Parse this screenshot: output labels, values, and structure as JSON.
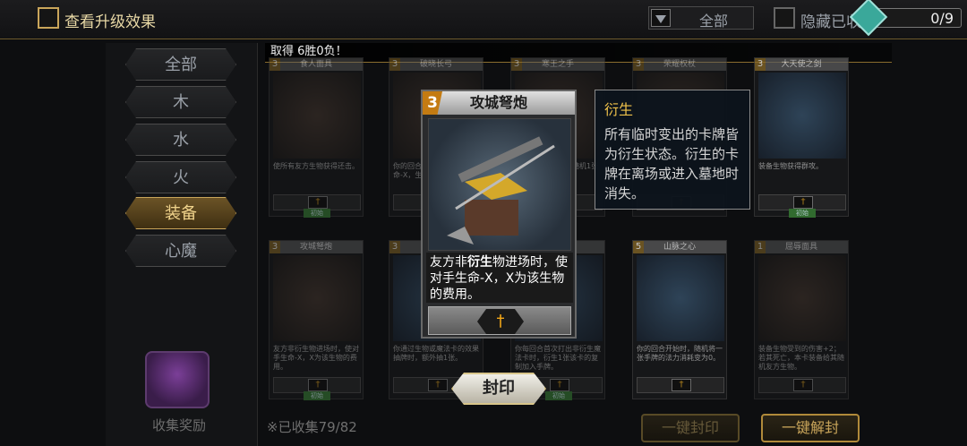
{
  "topbar": {
    "show_upgrade_label": "查看升级效果",
    "filter_value": "全部",
    "hide_label": "隐藏已收",
    "counter": "0/9"
  },
  "notice": "取得 6胜0负！",
  "sidebar": {
    "tabs": [
      {
        "label": "全部",
        "active": false
      },
      {
        "label": "木",
        "active": false
      },
      {
        "label": "水",
        "active": false
      },
      {
        "label": "火",
        "active": false
      },
      {
        "label": "装备",
        "active": true
      },
      {
        "label": "心魔",
        "active": false
      }
    ],
    "collect_label": "收集奖励"
  },
  "cards": [
    {
      "cost": "3",
      "title": "食人面具",
      "text": "使所有友方生物获得还击。",
      "tag": "初始"
    },
    {
      "cost": "3",
      "title": "破晓长弓",
      "text": "你的回合开始时，对友方生命-X，生物复苏。",
      "tag": ""
    },
    {
      "cost": "3",
      "title": "寒王之手",
      "text": "敌方生物进场时，随机1张",
      "tag": ""
    },
    {
      "cost": "3",
      "title": "荣耀权杖",
      "text": "",
      "tag": ""
    },
    {
      "cost": "3",
      "title": "大天使之剑",
      "text": "装备生物获得群攻。",
      "tag": "初始"
    },
    {
      "cost": "3",
      "title": "攻城弩炮",
      "text": "友方非衍生物进场时，使对手生命-X，X为该生物的费用。",
      "tag": "初始"
    },
    {
      "cost": "3",
      "title": "",
      "text": "你通过生物或魔法卡的效果抽牌时，额外抽1张。",
      "tag": ""
    },
    {
      "cost": "3",
      "title": "",
      "text": "你每回合首次打出非衍生魔法卡时，衍生1张该卡的复制加入手牌。",
      "tag": "初始"
    },
    {
      "cost": "5",
      "title": "山脉之心",
      "text": "你的回合开始时，随机将一张手牌的法力消耗变为0。",
      "tag": ""
    },
    {
      "cost": "1",
      "title": "屈辱面具",
      "text": "装备生物受到的伤害+2；若其死亡，本卡装备给其随机友方生物。",
      "tag": ""
    }
  ],
  "footnote": "※已收集79/82",
  "bottom_buttons": {
    "seal_all": "一键封印",
    "unseal_all": "一键解封"
  },
  "detail_card": {
    "cost": "3",
    "title": "攻城弩炮",
    "text_prefix": "友方非",
    "text_bold": "衍生",
    "text_suffix": "物进场时，使对手生命-X，X为该生物的费用。",
    "icon": "dagger-icon"
  },
  "tooltip": {
    "title": "衍生",
    "desc": "所有临时变出的卡牌皆为衍生状态。衍生的卡牌在离场或进入墓地时消失。"
  },
  "seal_button": "封印",
  "colors": {
    "gold": "#c9a55a",
    "accent_orange": "#f2a618",
    "tag_green": "#3d8a3a"
  }
}
